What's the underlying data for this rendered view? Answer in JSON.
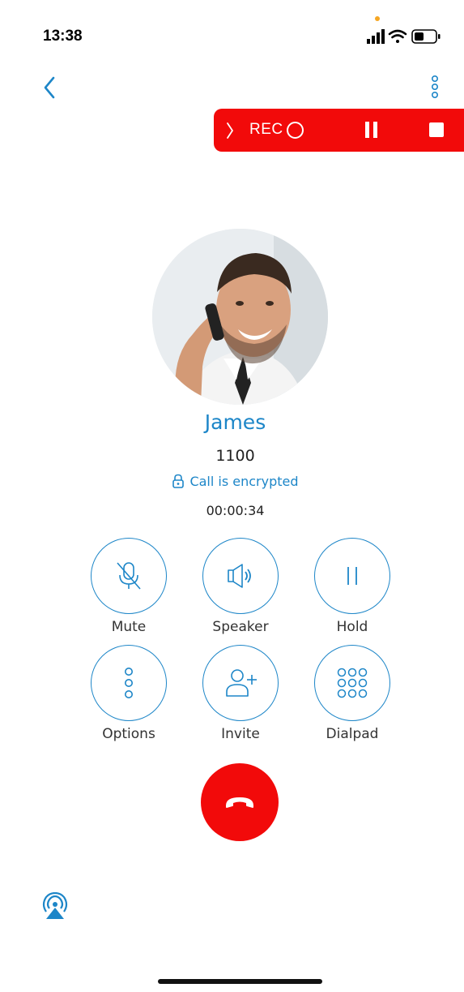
{
  "status_bar": {
    "time": "13:38"
  },
  "recording_bar": {
    "label": "REC"
  },
  "caller": {
    "name": "James",
    "number": "1100",
    "encryption_status": "Call is encrypted",
    "duration": "00:00:34"
  },
  "controls": {
    "mute": "Mute",
    "speaker": "Speaker",
    "hold": "Hold",
    "options": "Options",
    "invite": "Invite",
    "dialpad": "Dialpad"
  },
  "colors": {
    "accent": "#1d86c8",
    "danger": "#f20a0a"
  },
  "icons": [
    "back-chevron-icon",
    "more-vertical-icon",
    "chevron-right-icon",
    "pause-icon",
    "stop-icon",
    "mic-off-icon",
    "speaker-icon",
    "hold-icon",
    "options-icon",
    "invite-user-icon",
    "dialpad-icon",
    "hangup-icon",
    "airplay-icon",
    "lock-icon"
  ]
}
